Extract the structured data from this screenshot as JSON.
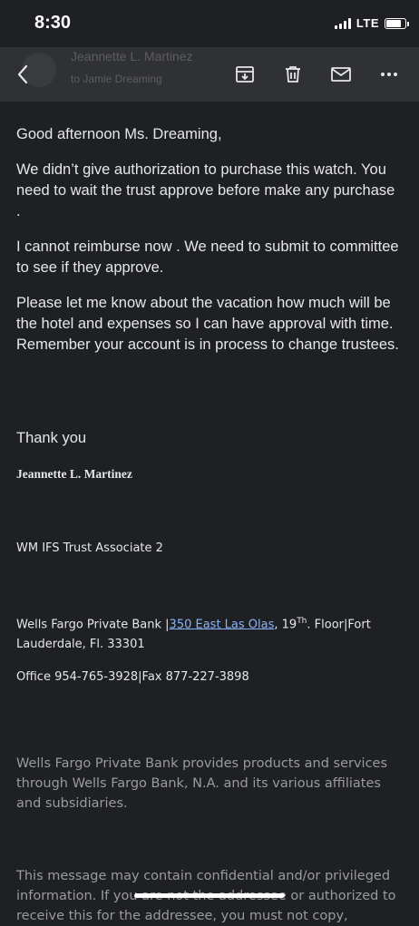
{
  "status": {
    "time": "8:30",
    "network": "LTE"
  },
  "header": {
    "sender_name": "Jeannette L. Martinez",
    "sender_sub": "to Jamie Dreaming"
  },
  "toolbar": {
    "back_icon": "chevron-left-icon",
    "archive_icon": "archive-icon",
    "trash_icon": "trash-icon",
    "mail_icon": "mail-icon",
    "more_icon": "more-horizontal-icon"
  },
  "email": {
    "greeting": "Good afternoon Ms. Dreaming,",
    "paragraph1": "We didn’t give authorization to purchase this watch. You need to wait the trust approve before make any purchase .",
    "paragraph2": "I cannot reimburse now . We need to submit to committee to see if they approve.",
    "paragraph3": "Please let me know about the vacation how much will be the hotel and expenses so I can have approval with time. Remember your account is in process to change trustees.",
    "closing": "Thank you",
    "signature_name": "Jeannette L. Martinez",
    "signature_title": "WM IFS Trust Associate 2",
    "address_prefix": "Wells Fargo Private Bank |",
    "address_link": "350 East Las Olas",
    "address_mid": ", 19",
    "address_sup": "Th",
    "address_suffix": ". Floor|Fort Lauderdale, Fl. 33301",
    "office_line": "Office 954-765-3928|Fax 877-227-3898",
    "disclaimer1": "Wells Fargo Private Bank provides products and services through Wells Fargo Bank, N.A. and its various affiliates and subsidiaries.",
    "disclaimer2": "This message may contain confidential and/or privileged information. If you are not the addressee or authorized to receive this for the addressee, you must not copy,"
  },
  "colors": {
    "background": "#1f2023",
    "toolbar": "#303134",
    "link": "#8ab4f8",
    "muted": "#9a9ba0"
  }
}
